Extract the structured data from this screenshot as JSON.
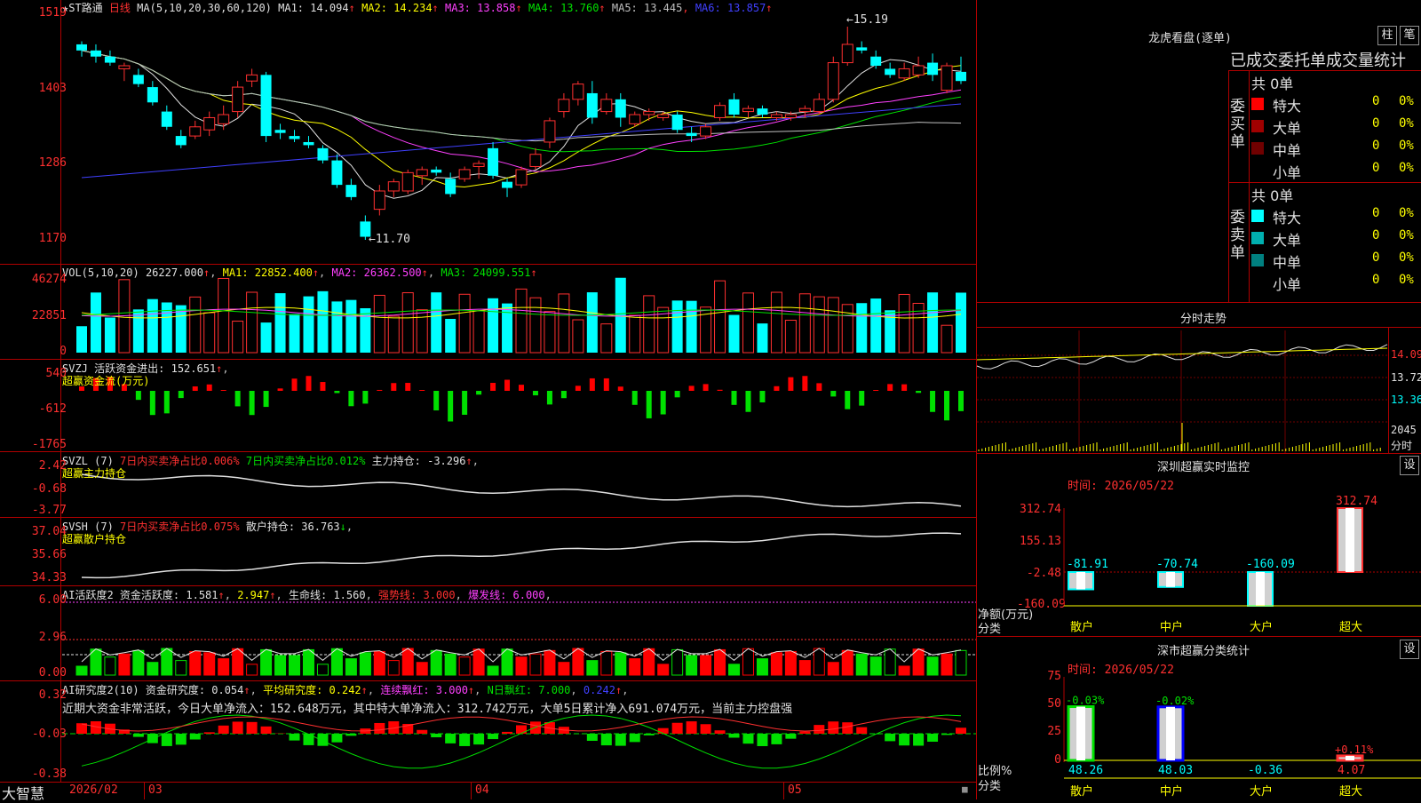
{
  "app_name": "大智慧",
  "stock_title": "★ST路通",
  "period": "日线",
  "main_panel": {
    "ma_label": "MA(5,10,20,30,60,120)",
    "ma_values": [
      {
        "name": "MA1",
        "value": "14.094",
        "arrow": "↑",
        "color": "#e0e0e0"
      },
      {
        "name": "MA2",
        "value": "14.234",
        "arrow": "↑",
        "color": "#ffff00"
      },
      {
        "name": "MA3",
        "value": "13.858",
        "arrow": "↑",
        "color": "#ff40ff"
      },
      {
        "name": "MA4",
        "value": "13.760",
        "arrow": "↑",
        "color": "#00e000"
      },
      {
        "name": "MA5",
        "value": "13.445",
        "arrow": ",",
        "color": "#c0c0c0"
      },
      {
        "name": "MA6",
        "value": "13.857",
        "arrow": "↑",
        "color": "#4040ff"
      }
    ],
    "y_ticks": [
      "1519",
      "1403",
      "1286",
      "1170"
    ],
    "high_label": "15.19",
    "low_label": "11.70"
  },
  "vol_panel": {
    "label": "VOL(5,10,20)",
    "vol": "26227.000",
    "ma1": "22852.400",
    "ma2": "26362.500",
    "ma3": "24099.551",
    "y_ticks": [
      "46274",
      "22851",
      "0"
    ]
  },
  "svzj_panel": {
    "label": "SVZJ",
    "text": "活跃资金进出: 152.651",
    "sub": "超赢资金流(万元)",
    "y_ticks": [
      "540",
      "-612",
      "-1765"
    ]
  },
  "svzl_panel": {
    "label": "SVZL (7)",
    "t1": "7日内买卖净占比0.006%",
    "t2": "7日内买卖净占比0.012%",
    "t3": "主力持仓: -3.296",
    "sub": "超赢主力持仓",
    "y_ticks": [
      "2.42",
      "-0.68",
      "-3.77"
    ]
  },
  "svsh_panel": {
    "label": "SVSH (7)",
    "t1": "7日内买卖净占比0.075%",
    "t2": "散户持仓: 36.763",
    "sub": "超赢散户持仓",
    "y_ticks": [
      "37.04",
      "35.66",
      "34.33"
    ]
  },
  "ai_active_panel": {
    "label": "AI活跃度2",
    "t1": "资金活跃度: 1.581",
    "t2": "2.947",
    "t3": "生命线: 1.560",
    "t4": "强势线: 3.000",
    "t5": "爆发线: 6.000",
    "y_ticks": [
      "6.00",
      "2.96",
      "0.00"
    ]
  },
  "ai_research_panel": {
    "label": "AI研究度2(10)",
    "t1": "资金研究度: 0.054",
    "t2": "平均研究度: 0.242",
    "t3": "连续飘红: 3.000",
    "t4": "N日飘红: 7.000",
    "t5": "0.242",
    "note": "近期大资金非常活跃，今日大单净流入：152.648万元，其中特大单净流入：312.742万元，大单5日累计净入691.074万元，当前主力控盘强",
    "y_ticks": [
      "0.32",
      "-0.03",
      "-0.38"
    ]
  },
  "x_axis": {
    "year_month": "2026/02",
    "m3": "03",
    "m4": "04",
    "m5": "05"
  },
  "right_panel": {
    "lhb_title": "龙虎看盘(逐单)",
    "btn_zhu": "柱",
    "btn_bi": "笔",
    "table_header": "已成交委托单成交量统计",
    "buy_label": "委买单",
    "sell_label": "委卖单",
    "buy_total": "共 0单",
    "sell_total": "共 0单",
    "buy_rows": [
      {
        "name": "特大",
        "v": "0",
        "p": "0%",
        "color": "#ff0000"
      },
      {
        "name": "大单",
        "v": "0",
        "p": "0%",
        "color": "#a00000"
      },
      {
        "name": "中单",
        "v": "0",
        "p": "0%",
        "color": "#700000"
      },
      {
        "name": "小单",
        "v": "0",
        "p": "0%",
        "color": "#000000"
      }
    ],
    "sell_rows": [
      {
        "name": "特大",
        "v": "0",
        "p": "0%",
        "color": "#00ffff"
      },
      {
        "name": "大单",
        "v": "0",
        "p": "0%",
        "color": "#00b0b0"
      },
      {
        "name": "中单",
        "v": "0",
        "p": "0%",
        "color": "#008080"
      },
      {
        "name": "小单",
        "v": "0",
        "p": "0%",
        "color": "#000000"
      }
    ],
    "fenshi_title": "分时走势",
    "fenshi_y": [
      "14.09",
      "13.72",
      "13.36",
      "2045"
    ],
    "fenshi_unit": "分时",
    "sz_monitor_title": "深圳超赢实时监控",
    "set_btn": "设",
    "time_label": "时间: 2026/05/22",
    "monitor_y": [
      "312.74",
      "155.13",
      "-2.48",
      "-160.09"
    ],
    "monitor_bars": [
      {
        "cat": "散户",
        "value": -81.91,
        "label": "-81.91"
      },
      {
        "cat": "中户",
        "value": -70.74,
        "label": "-70.74"
      },
      {
        "cat": "大户",
        "value": -160.09,
        "label": "-160.09"
      },
      {
        "cat": "超大",
        "value": 312.74,
        "label": "312.74"
      }
    ],
    "monitor_unit": "净额(万元)",
    "monitor_x_title": "分类",
    "class_title": "深市超赢分类统计",
    "class_time": "时间: 2026/05/22",
    "class_y": [
      "75",
      "50",
      "25",
      "0"
    ],
    "class_bars": [
      {
        "cat": "散户",
        "value": 48.26,
        "label": "48.26",
        "delta": "-0.03%"
      },
      {
        "cat": "中户",
        "value": 48.03,
        "label": "48.03",
        "delta": "-0.02%"
      },
      {
        "cat": "大户",
        "value": -0.36,
        "label": "-0.36",
        "delta": ""
      },
      {
        "cat": "超大",
        "value": 4.07,
        "label": "4.07",
        "delta": "+0.11%"
      }
    ],
    "class_unit": "比例%",
    "class_x_title": "分类"
  },
  "chart_data": {
    "type": "candlestick",
    "y_range": [
      11.7,
      15.19
    ],
    "candles": [
      [
        14.9,
        14.95,
        14.7,
        14.8
      ],
      [
        14.8,
        14.9,
        14.6,
        14.7
      ],
      [
        14.7,
        14.8,
        14.55,
        14.6
      ],
      [
        14.5,
        14.6,
        14.3,
        14.55
      ],
      [
        14.4,
        14.5,
        14.2,
        14.25
      ],
      [
        14.2,
        14.3,
        13.9,
        13.95
      ],
      [
        13.8,
        13.9,
        13.5,
        13.55
      ],
      [
        13.4,
        13.5,
        13.2,
        13.25
      ],
      [
        13.4,
        13.65,
        13.35,
        13.55
      ],
      [
        13.5,
        13.8,
        13.4,
        13.7
      ],
      [
        13.6,
        13.9,
        13.5,
        13.75
      ],
      [
        13.8,
        14.3,
        13.7,
        14.2
      ],
      [
        14.3,
        14.5,
        14.2,
        14.4
      ],
      [
        14.4,
        14.45,
        13.3,
        13.4
      ],
      [
        13.5,
        13.6,
        13.35,
        13.45
      ],
      [
        13.4,
        13.5,
        13.3,
        13.35
      ],
      [
        13.3,
        13.4,
        13.2,
        13.25
      ],
      [
        13.2,
        13.25,
        12.95,
        13.0
      ],
      [
        13.0,
        13.1,
        12.55,
        12.6
      ],
      [
        12.6,
        12.7,
        12.35,
        12.4
      ],
      [
        12.0,
        12.1,
        11.7,
        11.75
      ],
      [
        12.2,
        12.6,
        12.1,
        12.5
      ],
      [
        12.5,
        12.7,
        12.4,
        12.65
      ],
      [
        12.5,
        12.85,
        12.45,
        12.8
      ],
      [
        12.75,
        12.9,
        12.6,
        12.85
      ],
      [
        12.85,
        12.9,
        12.75,
        12.8
      ],
      [
        12.7,
        12.8,
        12.4,
        12.45
      ],
      [
        12.7,
        12.9,
        12.65,
        12.85
      ],
      [
        12.9,
        13.0,
        12.7,
        12.95
      ],
      [
        13.2,
        13.3,
        12.7,
        12.75
      ],
      [
        12.65,
        12.7,
        12.4,
        12.55
      ],
      [
        12.6,
        12.9,
        12.55,
        12.85
      ],
      [
        12.9,
        13.2,
        12.85,
        13.1
      ],
      [
        13.3,
        13.7,
        13.2,
        13.65
      ],
      [
        13.8,
        14.1,
        13.7,
        14.0
      ],
      [
        14.0,
        14.3,
        13.9,
        14.25
      ],
      [
        14.1,
        14.3,
        13.6,
        13.7
      ],
      [
        13.8,
        14.1,
        13.75,
        14.0
      ],
      [
        14.0,
        14.1,
        13.55,
        13.7
      ],
      [
        13.6,
        13.8,
        13.55,
        13.75
      ],
      [
        13.75,
        13.85,
        13.65,
        13.8
      ],
      [
        13.7,
        13.8,
        13.65,
        13.75
      ],
      [
        13.75,
        13.8,
        13.45,
        13.5
      ],
      [
        13.45,
        13.55,
        13.3,
        13.4
      ],
      [
        13.4,
        13.6,
        13.35,
        13.55
      ],
      [
        13.7,
        13.95,
        13.65,
        13.9
      ],
      [
        14.0,
        14.1,
        13.7,
        13.75
      ],
      [
        13.8,
        13.9,
        13.7,
        13.85
      ],
      [
        13.85,
        13.9,
        13.7,
        13.75
      ],
      [
        13.7,
        13.8,
        13.65,
        13.75
      ],
      [
        13.7,
        13.8,
        13.65,
        13.75
      ],
      [
        13.8,
        13.9,
        13.7,
        13.85
      ],
      [
        13.8,
        14.1,
        13.75,
        14.0
      ],
      [
        14.0,
        14.7,
        13.95,
        14.6
      ],
      [
        14.6,
        15.19,
        14.55,
        14.9
      ],
      [
        14.85,
        14.95,
        14.75,
        14.8
      ],
      [
        14.7,
        14.8,
        14.5,
        14.55
      ],
      [
        14.5,
        14.6,
        14.35,
        14.4
      ],
      [
        14.35,
        14.6,
        14.3,
        14.5
      ],
      [
        14.4,
        14.7,
        14.35,
        14.55
      ],
      [
        14.6,
        14.75,
        14.3,
        14.4
      ],
      [
        14.15,
        14.6,
        14.1,
        14.55
      ],
      [
        14.45,
        14.7,
        14.25,
        14.3
      ]
    ]
  }
}
